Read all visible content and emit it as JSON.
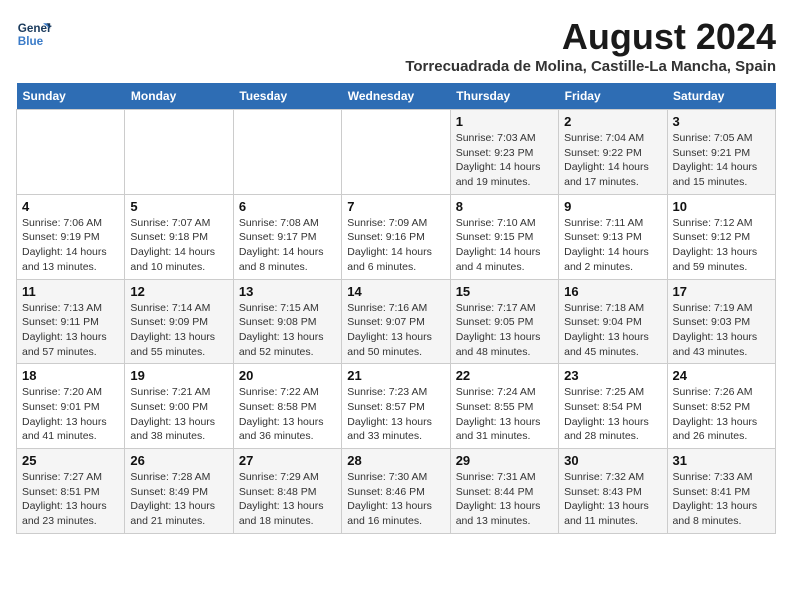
{
  "header": {
    "title": "August 2024",
    "subtitle": "Torrecuadrada de Molina, Castille-La Mancha, Spain",
    "logo_line1": "General",
    "logo_line2": "Blue"
  },
  "weekdays": [
    "Sunday",
    "Monday",
    "Tuesday",
    "Wednesday",
    "Thursday",
    "Friday",
    "Saturday"
  ],
  "weeks": [
    [
      {
        "day": "",
        "info": ""
      },
      {
        "day": "",
        "info": ""
      },
      {
        "day": "",
        "info": ""
      },
      {
        "day": "",
        "info": ""
      },
      {
        "day": "1",
        "info": "Sunrise: 7:03 AM\nSunset: 9:23 PM\nDaylight: 14 hours and 19 minutes."
      },
      {
        "day": "2",
        "info": "Sunrise: 7:04 AM\nSunset: 9:22 PM\nDaylight: 14 hours and 17 minutes."
      },
      {
        "day": "3",
        "info": "Sunrise: 7:05 AM\nSunset: 9:21 PM\nDaylight: 14 hours and 15 minutes."
      }
    ],
    [
      {
        "day": "4",
        "info": "Sunrise: 7:06 AM\nSunset: 9:19 PM\nDaylight: 14 hours and 13 minutes."
      },
      {
        "day": "5",
        "info": "Sunrise: 7:07 AM\nSunset: 9:18 PM\nDaylight: 14 hours and 10 minutes."
      },
      {
        "day": "6",
        "info": "Sunrise: 7:08 AM\nSunset: 9:17 PM\nDaylight: 14 hours and 8 minutes."
      },
      {
        "day": "7",
        "info": "Sunrise: 7:09 AM\nSunset: 9:16 PM\nDaylight: 14 hours and 6 minutes."
      },
      {
        "day": "8",
        "info": "Sunrise: 7:10 AM\nSunset: 9:15 PM\nDaylight: 14 hours and 4 minutes."
      },
      {
        "day": "9",
        "info": "Sunrise: 7:11 AM\nSunset: 9:13 PM\nDaylight: 14 hours and 2 minutes."
      },
      {
        "day": "10",
        "info": "Sunrise: 7:12 AM\nSunset: 9:12 PM\nDaylight: 13 hours and 59 minutes."
      }
    ],
    [
      {
        "day": "11",
        "info": "Sunrise: 7:13 AM\nSunset: 9:11 PM\nDaylight: 13 hours and 57 minutes."
      },
      {
        "day": "12",
        "info": "Sunrise: 7:14 AM\nSunset: 9:09 PM\nDaylight: 13 hours and 55 minutes."
      },
      {
        "day": "13",
        "info": "Sunrise: 7:15 AM\nSunset: 9:08 PM\nDaylight: 13 hours and 52 minutes."
      },
      {
        "day": "14",
        "info": "Sunrise: 7:16 AM\nSunset: 9:07 PM\nDaylight: 13 hours and 50 minutes."
      },
      {
        "day": "15",
        "info": "Sunrise: 7:17 AM\nSunset: 9:05 PM\nDaylight: 13 hours and 48 minutes."
      },
      {
        "day": "16",
        "info": "Sunrise: 7:18 AM\nSunset: 9:04 PM\nDaylight: 13 hours and 45 minutes."
      },
      {
        "day": "17",
        "info": "Sunrise: 7:19 AM\nSunset: 9:03 PM\nDaylight: 13 hours and 43 minutes."
      }
    ],
    [
      {
        "day": "18",
        "info": "Sunrise: 7:20 AM\nSunset: 9:01 PM\nDaylight: 13 hours and 41 minutes."
      },
      {
        "day": "19",
        "info": "Sunrise: 7:21 AM\nSunset: 9:00 PM\nDaylight: 13 hours and 38 minutes."
      },
      {
        "day": "20",
        "info": "Sunrise: 7:22 AM\nSunset: 8:58 PM\nDaylight: 13 hours and 36 minutes."
      },
      {
        "day": "21",
        "info": "Sunrise: 7:23 AM\nSunset: 8:57 PM\nDaylight: 13 hours and 33 minutes."
      },
      {
        "day": "22",
        "info": "Sunrise: 7:24 AM\nSunset: 8:55 PM\nDaylight: 13 hours and 31 minutes."
      },
      {
        "day": "23",
        "info": "Sunrise: 7:25 AM\nSunset: 8:54 PM\nDaylight: 13 hours and 28 minutes."
      },
      {
        "day": "24",
        "info": "Sunrise: 7:26 AM\nSunset: 8:52 PM\nDaylight: 13 hours and 26 minutes."
      }
    ],
    [
      {
        "day": "25",
        "info": "Sunrise: 7:27 AM\nSunset: 8:51 PM\nDaylight: 13 hours and 23 minutes."
      },
      {
        "day": "26",
        "info": "Sunrise: 7:28 AM\nSunset: 8:49 PM\nDaylight: 13 hours and 21 minutes."
      },
      {
        "day": "27",
        "info": "Sunrise: 7:29 AM\nSunset: 8:48 PM\nDaylight: 13 hours and 18 minutes."
      },
      {
        "day": "28",
        "info": "Sunrise: 7:30 AM\nSunset: 8:46 PM\nDaylight: 13 hours and 16 minutes."
      },
      {
        "day": "29",
        "info": "Sunrise: 7:31 AM\nSunset: 8:44 PM\nDaylight: 13 hours and 13 minutes."
      },
      {
        "day": "30",
        "info": "Sunrise: 7:32 AM\nSunset: 8:43 PM\nDaylight: 13 hours and 11 minutes."
      },
      {
        "day": "31",
        "info": "Sunrise: 7:33 AM\nSunset: 8:41 PM\nDaylight: 13 hours and 8 minutes."
      }
    ]
  ]
}
